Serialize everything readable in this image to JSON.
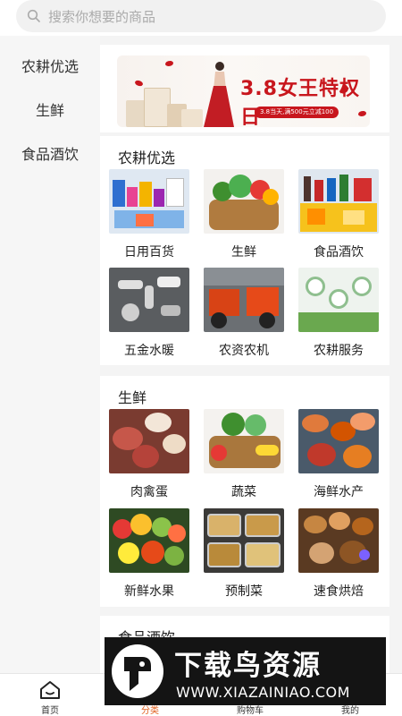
{
  "search": {
    "placeholder": "搜索你想要的商品"
  },
  "sidebar": {
    "items": [
      {
        "label": "农耕优选"
      },
      {
        "label": "生鲜"
      },
      {
        "label": "食品酒饮"
      }
    ]
  },
  "banner": {
    "title": "3.8女王特权日",
    "subtitle": "3.8当天,满500元立减100"
  },
  "sections": [
    {
      "title": "农耕优选",
      "items": [
        {
          "label": "日用百货"
        },
        {
          "label": "生鲜"
        },
        {
          "label": "食品酒饮"
        },
        {
          "label": "五金水暖"
        },
        {
          "label": "农资农机"
        },
        {
          "label": "农耕服务"
        }
      ]
    },
    {
      "title": "生鲜",
      "items": [
        {
          "label": "肉禽蛋"
        },
        {
          "label": "蔬菜"
        },
        {
          "label": "海鲜水产"
        },
        {
          "label": "新鲜水果"
        },
        {
          "label": "预制菜"
        },
        {
          "label": "速食烘焙"
        }
      ]
    },
    {
      "title": "食品酒饮"
    }
  ],
  "tabbar": {
    "items": [
      {
        "label": "首页"
      },
      {
        "label": "分类"
      },
      {
        "label": "购物车"
      },
      {
        "label": "我的"
      }
    ],
    "active_color": "#e0601f"
  },
  "watermark": {
    "title": "下载鸟资源",
    "url": "WWW.XIAZAINIAO.COM"
  }
}
